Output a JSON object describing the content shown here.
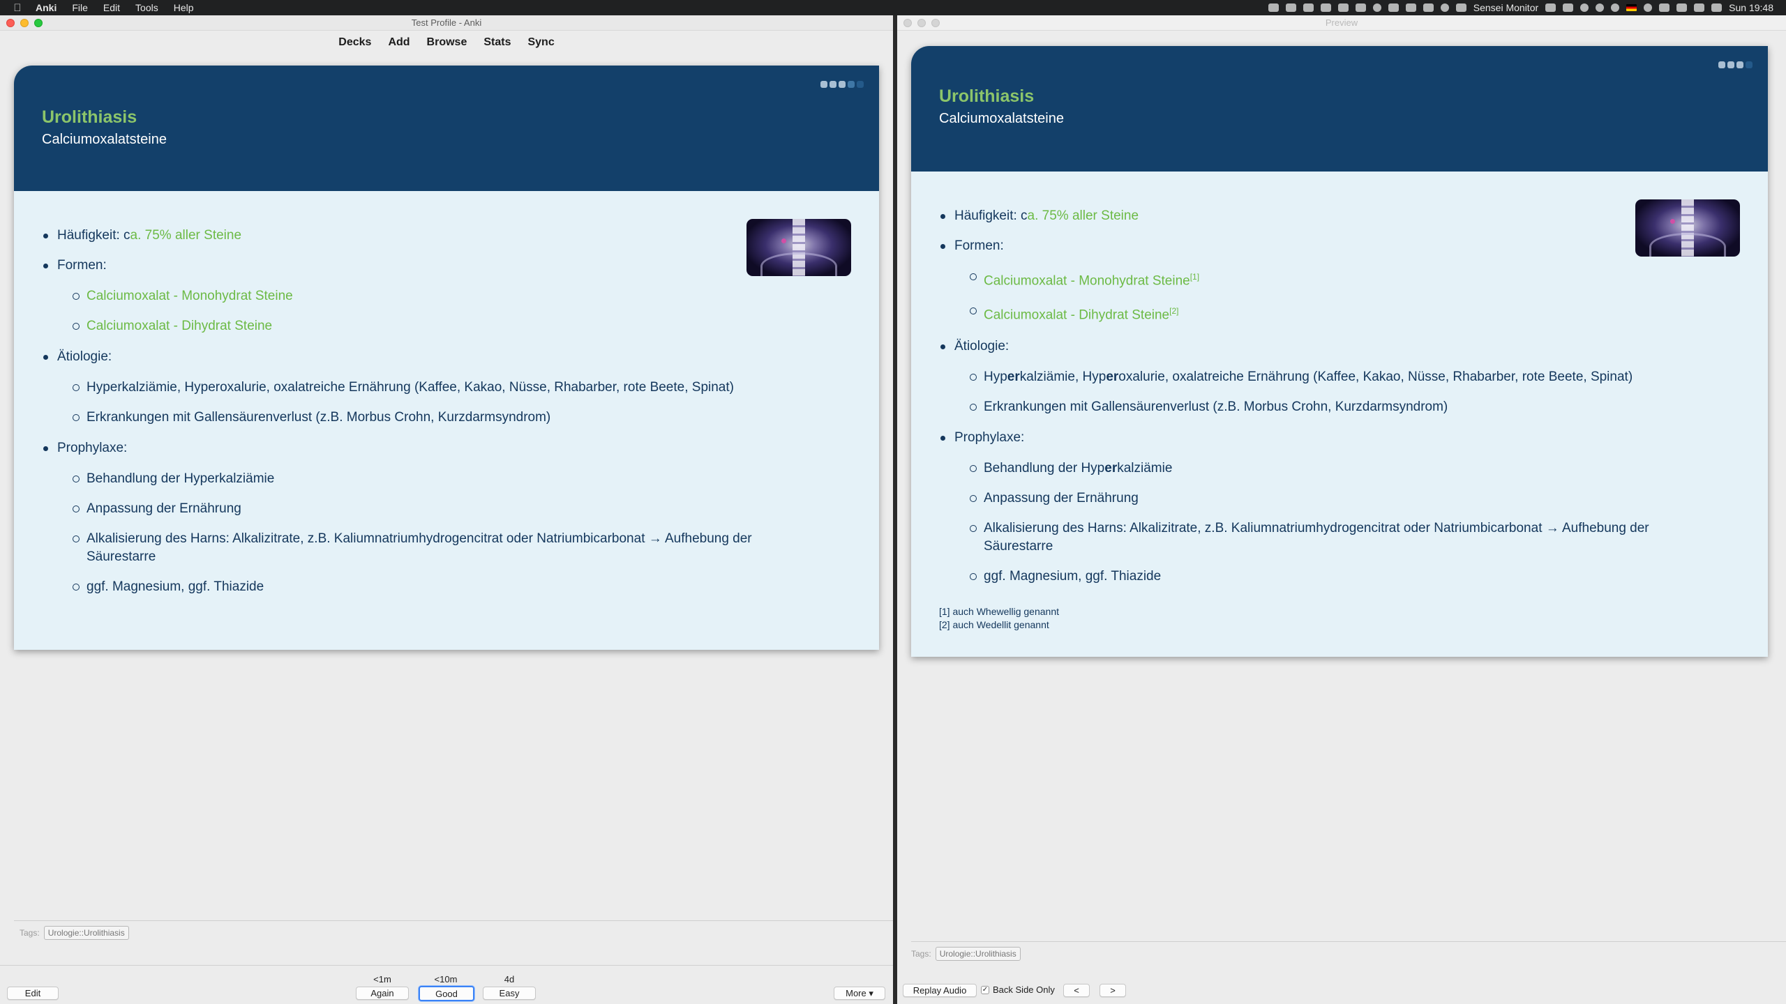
{
  "menubar": {
    "app_name": "Anki",
    "items": [
      "File",
      "Edit",
      "Tools",
      "Help"
    ],
    "status_text": "Sensei Monitor",
    "clock": "Sun 19:48"
  },
  "main_window": {
    "title": "Test Profile - Anki",
    "toolbar": [
      "Decks",
      "Add",
      "Browse",
      "Stats",
      "Sync"
    ],
    "tags_label": "Tags:",
    "tag": "Urologie::Urolithiasis",
    "edit_button": "Edit",
    "more_button": "More ▾",
    "answers": [
      {
        "due": "<1m",
        "label": "Again"
      },
      {
        "due": "<10m",
        "label": "Good"
      },
      {
        "due": "4d",
        "label": "Easy"
      }
    ]
  },
  "card_front": {
    "title": "Urolithiasis",
    "subtitle": "Calciumoxalatsteine",
    "haeufigkeit_label": "Häufigkeit: c",
    "haeufigkeit_value": "a. 75% aller Steine",
    "formen_label": "Formen:",
    "formen": [
      "Calciumoxalat - Monohydrat Steine",
      "Calciumoxalat - Dihydrat Steine"
    ],
    "aetiologie_label": "Ätiologie:",
    "aetiologie": [
      "Hyperkalziämie, Hyperoxalurie, oxalatreiche Ernährung (Kaffee, Kakao, Nüsse, Rhabarber, rote Beete, Spinat)",
      "Erkrankungen mit Gallensäurenverlust (z.B. Morbus Crohn, Kurzdarmsyndrom)"
    ],
    "prophylaxe_label": "Prophylaxe:",
    "prophylaxe": [
      "Behandlung der Hyperkalziämie",
      "Anpassung der Ernährung",
      "Alkalisierung des Harns: Alkalizitrate, z.B. Kaliumnatriumhydrogencitrat oder Natriumbicarbonat → Aufhebung der Säurestarre",
      "ggf. Magnesium, ggf. Thiazide"
    ]
  },
  "preview_window": {
    "title": "Preview",
    "tags_label": "Tags:",
    "tag": "Urologie::Urolithiasis",
    "replay_button": "Replay Audio",
    "back_side_label": "Back Side Only",
    "back_side_checked": true,
    "prev_button": "<",
    "next_button": ">"
  },
  "card_preview": {
    "title": "Urolithiasis",
    "subtitle": "Calciumoxalatsteine",
    "haeufigkeit_label": "Häufigkeit: c",
    "haeufigkeit_value": "a. 75% aller Steine",
    "formen_label": "Formen:",
    "formen": [
      "Calciumoxalat - Monohydrat Steine",
      "Calciumoxalat - Dihydrat Steine"
    ],
    "formen_refs": [
      "[1]",
      "[2]"
    ],
    "aetiologie_label": "Ätiologie:",
    "aetiologie_1": {
      "a": "Hyp",
      "b": "er",
      "c": "kalziämie, Hyp",
      "d": "er",
      "e": "oxalurie, oxalatreiche Ernährung (Kaffee, Kakao, Nüsse, Rhabarber, rote Beete, Spinat)"
    },
    "aetiologie_2": "Erkrankungen mit Gallensäurenverlust (z.B. Morbus Crohn, Kurzdarmsyndrom)",
    "prophylaxe_label": "Prophylaxe:",
    "prophylaxe_1": {
      "a": "Behandlung der Hyp",
      "b": "er",
      "c": "kalziämie"
    },
    "prophylaxe": [
      "Anpassung der Ernährung",
      "Alkalisierung des Harns: Alkalizitrate, z.B. Kaliumnatriumhydrogencitrat oder Natriumbicarbonat → Aufhebung der Säurestarre",
      "ggf. Magnesium, ggf. Thiazide"
    ],
    "footnotes": [
      "[1] auch Whewellig genannt",
      "[2] auch Wedellit genannt"
    ]
  },
  "colors": {
    "header": "#13406a",
    "accent_green": "#6cba45",
    "card_bg": "#e5f2f8",
    "text": "#14375c"
  }
}
